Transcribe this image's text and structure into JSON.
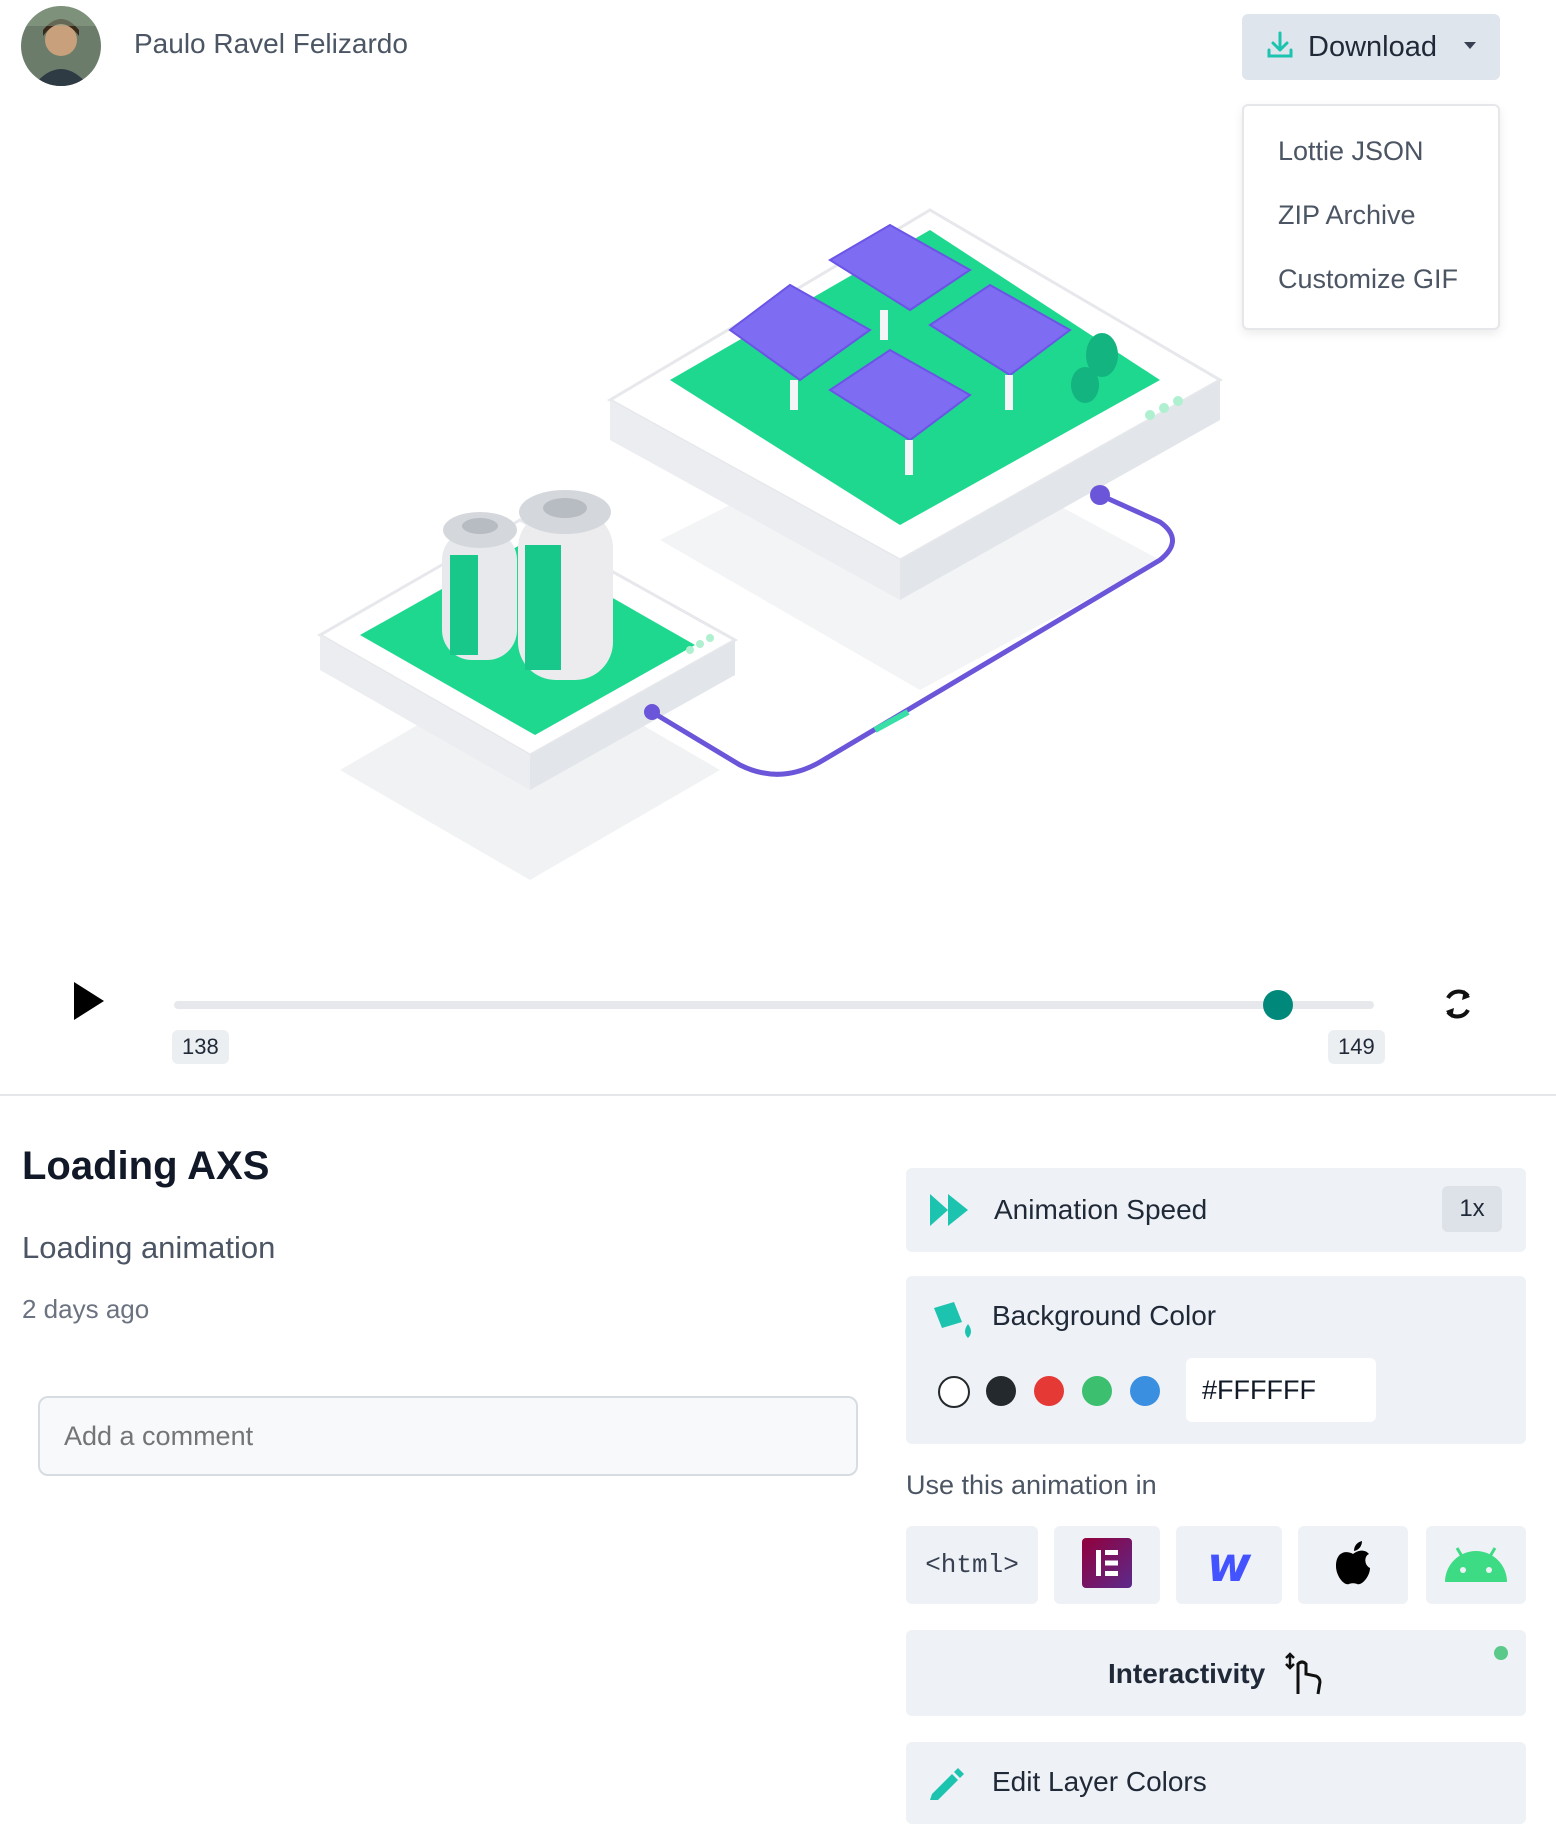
{
  "header": {
    "author_name": "Paulo Ravel Felizardo",
    "download_label": "Download",
    "download_menu": [
      "Lottie JSON",
      "ZIP Archive",
      "Customize GIF"
    ]
  },
  "player": {
    "current_frame": "138",
    "total_frames": "149",
    "progress": 0.92
  },
  "details": {
    "title": "Loading AXS",
    "description": "Loading animation",
    "posted": "2 days ago",
    "comment_placeholder": "Add a comment"
  },
  "panel": {
    "speed_label": "Animation Speed",
    "speed_value": "1x",
    "bg_label": "Background Color",
    "bg_swatches": [
      "#ffffff",
      "#24292e",
      "#e53935",
      "#3cbf6e",
      "#3b8fe0"
    ],
    "bg_hex": "#FFFFFF",
    "use_in_label": "Use this animation in",
    "platforms": [
      "<html>",
      "elementor-icon",
      "webflow-icon",
      "apple-icon",
      "android-icon"
    ],
    "html_tag": "<html>",
    "webflow_glyph": "w",
    "interactivity_label": "Interactivity",
    "edit_colors_label": "Edit Layer Colors"
  },
  "colors": {
    "accent": "#00a08a",
    "knob": "#00897b",
    "panel_bg": "#eef1f5",
    "status_dot": "#5ac98a"
  }
}
